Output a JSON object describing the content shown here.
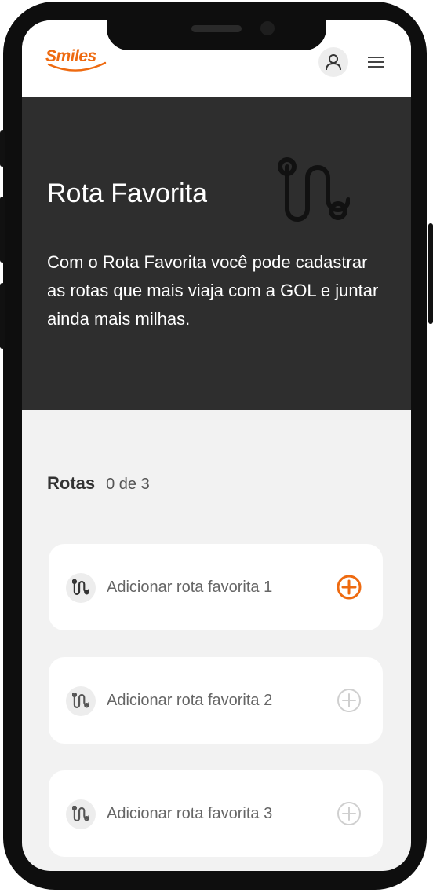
{
  "header": {
    "logo_text": "Smiles",
    "profile_icon": "user-icon",
    "menu_icon": "hamburger-icon"
  },
  "hero": {
    "title": "Rota Favorita",
    "icon": "route-icon",
    "description": "Com o Rota Favorita você pode cadastrar as rotas que mais viaja com a GOL e juntar ainda mais milhas."
  },
  "routes": {
    "title": "Rotas",
    "count": "0 de 3",
    "items": [
      {
        "label": "Adicionar rota favorita 1",
        "active": true
      },
      {
        "label": "Adicionar rota favorita 2",
        "active": false
      },
      {
        "label": "Adicionar rota favorita 3",
        "active": false
      }
    ]
  },
  "colors": {
    "brand": "#ee6a10",
    "hero_bg": "#2e2e2e",
    "page_bg": "#f2f2f2",
    "disabled": "#cfcfcf"
  }
}
